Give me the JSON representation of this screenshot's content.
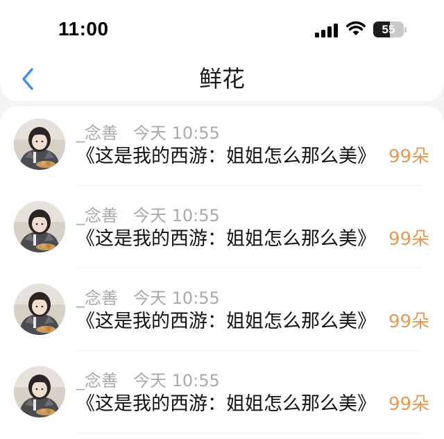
{
  "status_bar": {
    "time": "11:00",
    "signal_icon": "cellular-signal-icon",
    "wifi_icon": "wifi-icon",
    "battery_level": "55",
    "battery_fraction": 0.55
  },
  "nav": {
    "back_icon": "chevron-left-icon",
    "title": "鲜花"
  },
  "colors": {
    "accent_blue": "#3b8ef0",
    "count_orange": "#e49a52",
    "meta_gray": "#a8a8ad"
  },
  "gifts": [
    {
      "sender": "_念善",
      "time": "今天 10:55",
      "message": "《这是我的西游：姐姐怎么那么美》",
      "count": "99朵"
    },
    {
      "sender": "_念善",
      "time": "今天 10:55",
      "message": "《这是我的西游：姐姐怎么那么美》",
      "count": "99朵"
    },
    {
      "sender": "_念善",
      "time": "今天 10:55",
      "message": "《这是我的西游：姐姐怎么那么美》",
      "count": "99朵"
    },
    {
      "sender": "_念善",
      "time": "今天 10:55",
      "message": "《这是我的西游：姐姐怎么那么美》",
      "count": "99朵"
    }
  ]
}
